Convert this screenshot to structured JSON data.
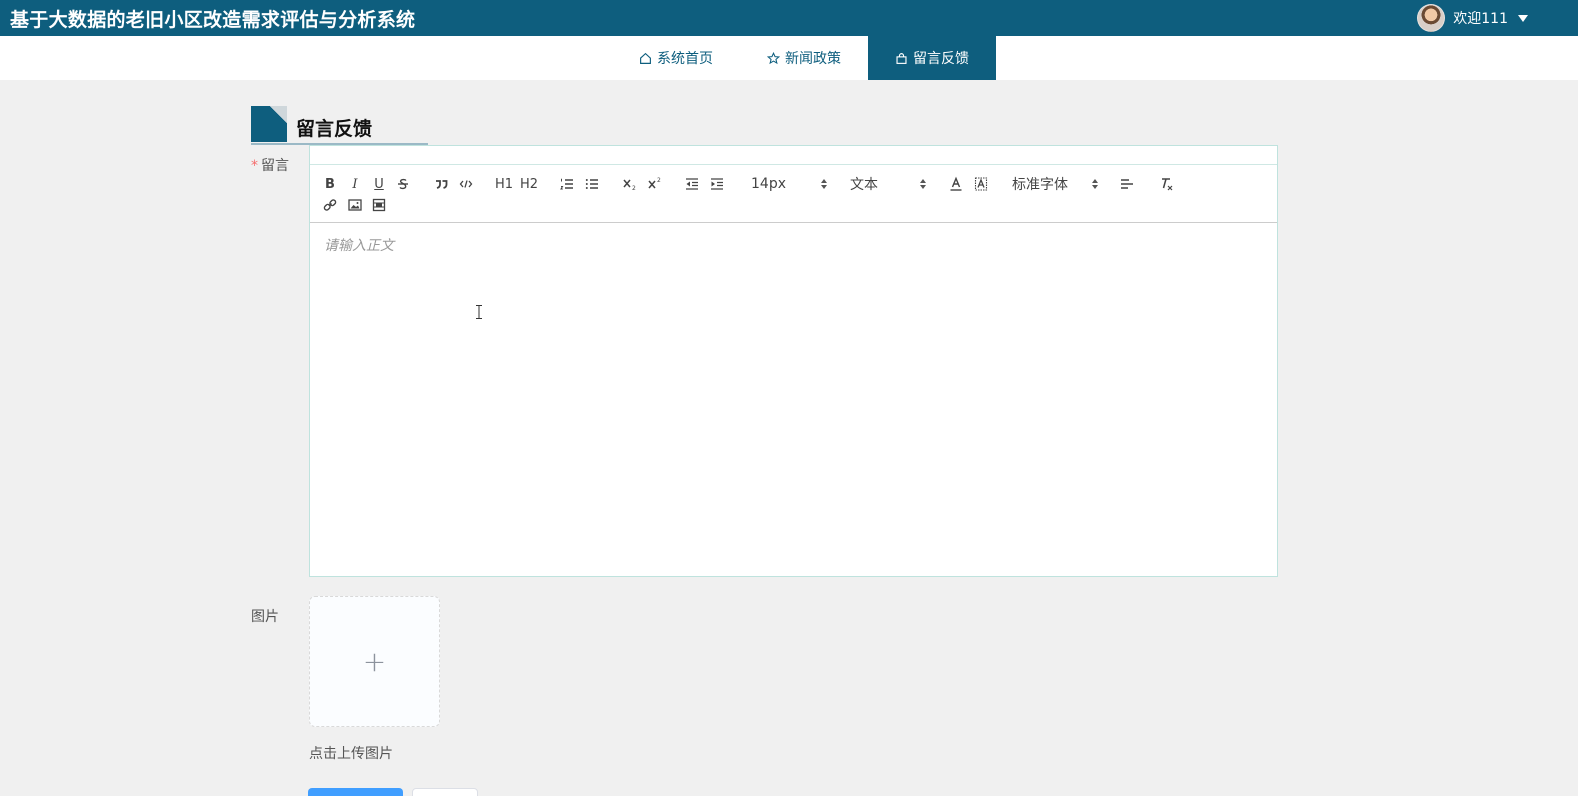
{
  "header": {
    "title": "基于大数据的老旧小区改造需求评估与分析系统",
    "welcome": "欢迎111"
  },
  "nav": {
    "items": [
      {
        "label": "系统首页",
        "icon": "home-icon"
      },
      {
        "label": "新闻政策",
        "icon": "star-icon"
      },
      {
        "label": "留言反馈",
        "icon": "bag-icon",
        "active": true
      }
    ]
  },
  "section": {
    "title": "留言反馈"
  },
  "form": {
    "message_label": "留言",
    "required_mark": "*",
    "editor": {
      "placeholder": "请输入正文",
      "font_size": "14px",
      "header_format": "文本",
      "font_family": "标准字体",
      "tools": {
        "bold": "B",
        "italic": "I",
        "underline": "U",
        "h1": "H1",
        "h2": "H2"
      }
    },
    "image_label": "图片",
    "upload_tip": "点击上传图片",
    "upload_plus": "+"
  },
  "colors": {
    "primary": "#0e5e7e",
    "button_primary": "#409eff",
    "required": "#f56c6c"
  }
}
